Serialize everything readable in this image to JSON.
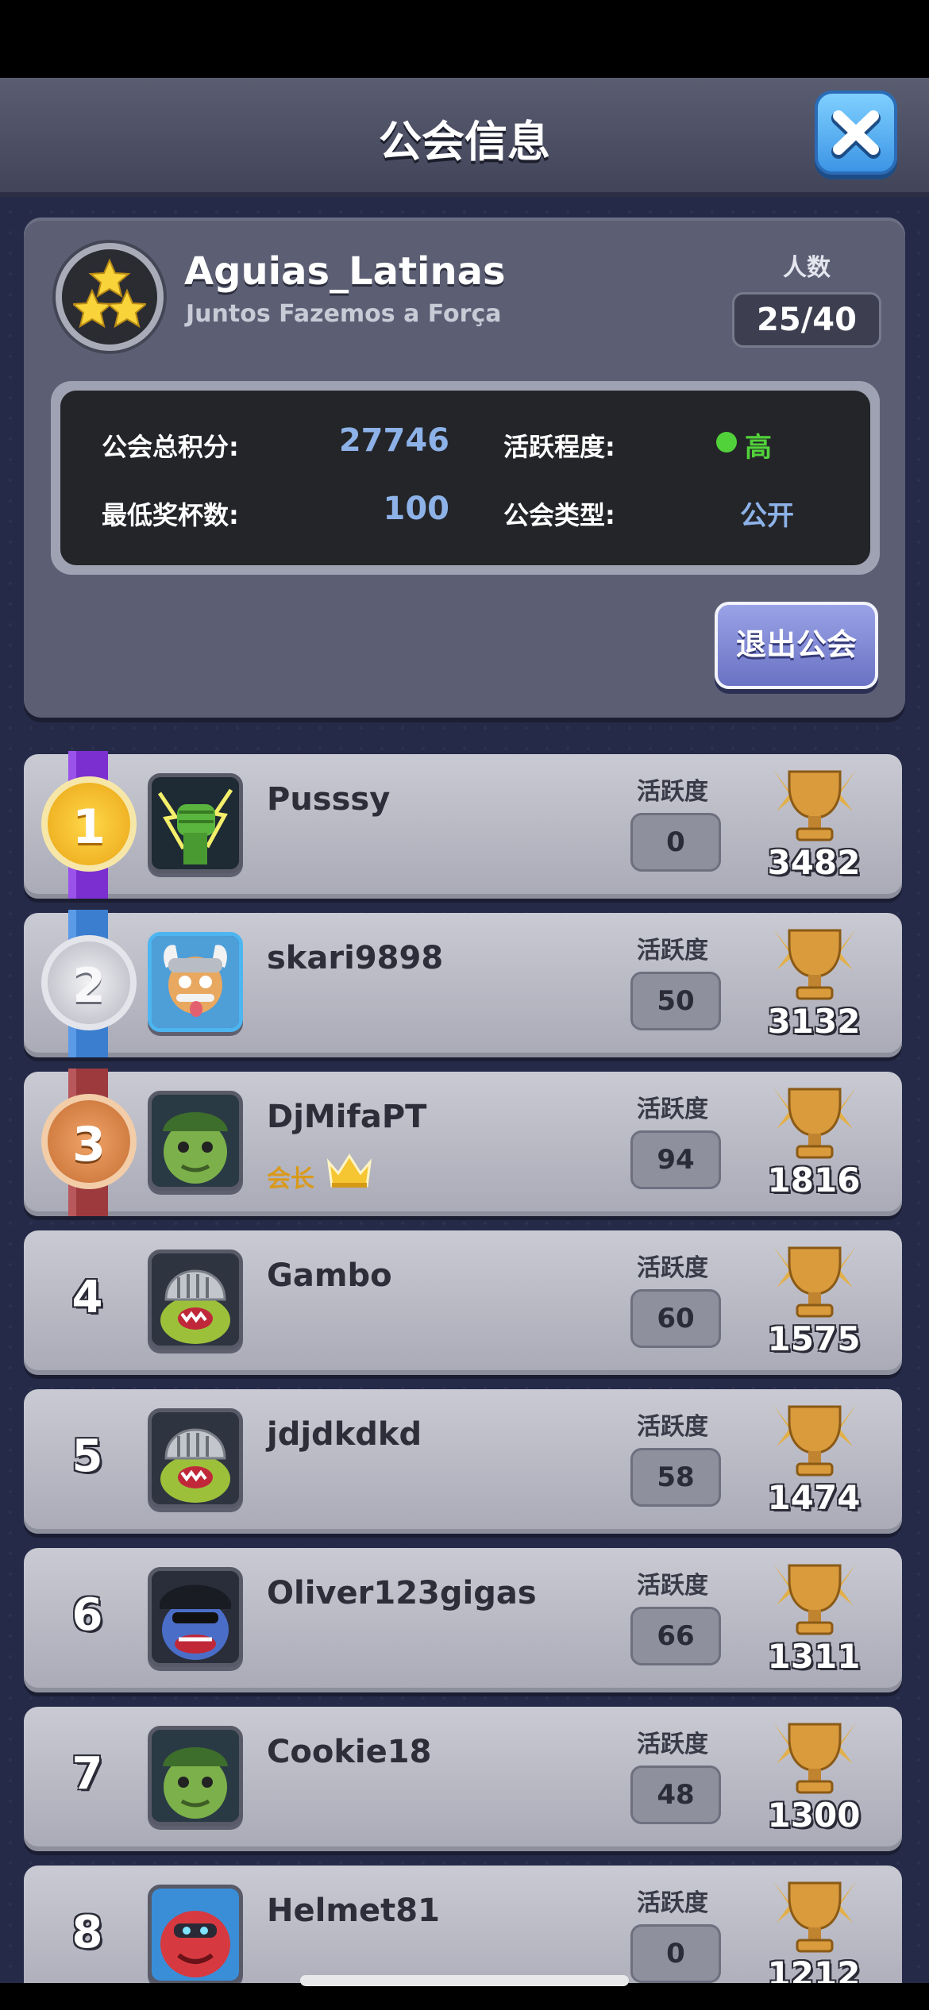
{
  "header": {
    "title": "公会信息",
    "close_icon": "close-x-icon"
  },
  "guild": {
    "name": "Aguias_Latinas",
    "motto": "Juntos Fazemos a Força",
    "emblem_icon": "three-stars-icon",
    "members_label": "人数",
    "members_value": "25/40",
    "stats": {
      "total_points_label": "公会总积分:",
      "total_points_value": "27746",
      "activity_label": "活跃程度:",
      "activity_value": "高",
      "min_trophies_label": "最低奖杯数:",
      "min_trophies_value": "100",
      "type_label": "公会类型:",
      "type_value": "公开"
    },
    "leave_button": "退出公会"
  },
  "members": [
    {
      "rank": "1",
      "name": "Pusssy",
      "activity_label": "活跃度",
      "activity": "0",
      "trophies": "3482"
    },
    {
      "rank": "2",
      "name": "skari9898",
      "activity_label": "活跃度",
      "activity": "50",
      "trophies": "3132"
    },
    {
      "rank": "3",
      "name": "DjMifaPT",
      "role": "会长",
      "activity_label": "活跃度",
      "activity": "94",
      "trophies": "1816"
    },
    {
      "rank": "4",
      "name": "Gambo",
      "activity_label": "活跃度",
      "activity": "60",
      "trophies": "1575"
    },
    {
      "rank": "5",
      "name": "jdjdkdkd",
      "activity_label": "活跃度",
      "activity": "58",
      "trophies": "1474"
    },
    {
      "rank": "6",
      "name": "Oliver123gigas",
      "activity_label": "活跃度",
      "activity": "66",
      "trophies": "1311"
    },
    {
      "rank": "7",
      "name": "Cookie18",
      "activity_label": "活跃度",
      "activity": "48",
      "trophies": "1300"
    },
    {
      "rank": "8",
      "name": "Helmet81",
      "activity_label": "活跃度",
      "activity": "0",
      "trophies": "1212"
    }
  ],
  "colors": {
    "accent_blue": "#8db2e8",
    "activity_high": "#52d23a",
    "leader": "#d99a1c"
  }
}
